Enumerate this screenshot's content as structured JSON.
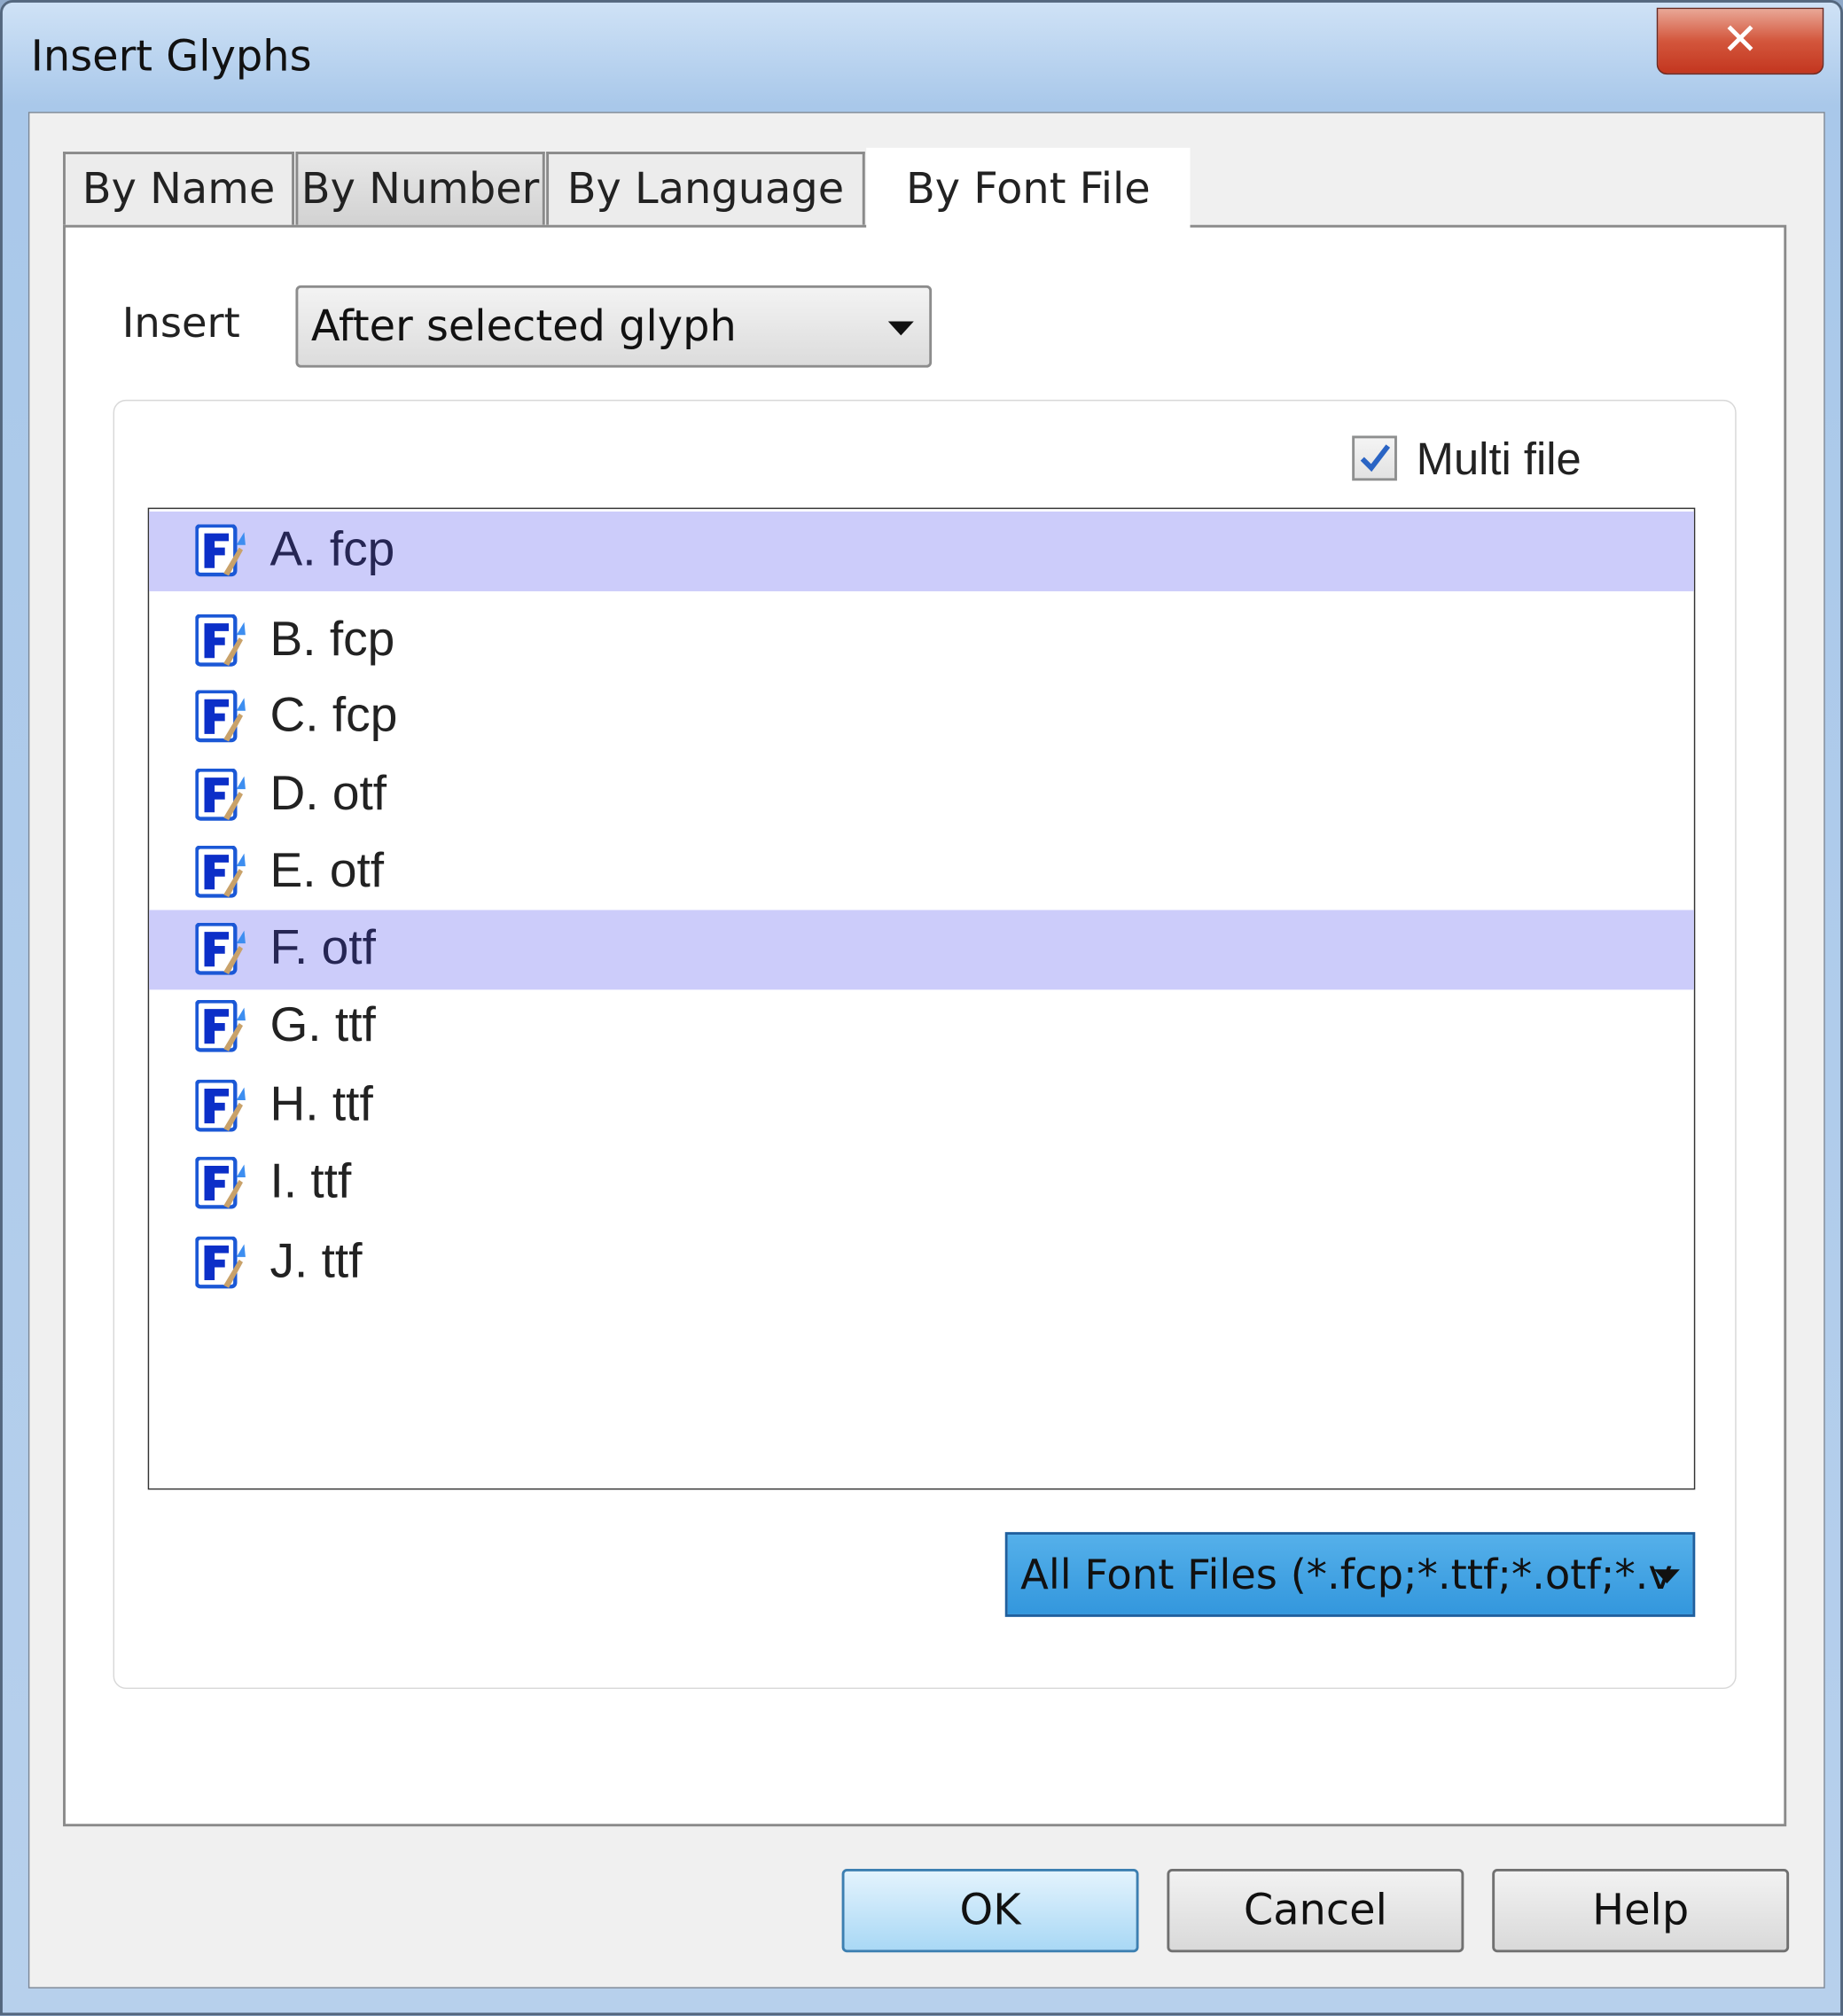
{
  "window": {
    "title": "Insert Glyphs",
    "close_icon": "close-icon"
  },
  "tabs": [
    {
      "label": "By Name"
    },
    {
      "label": "By Number"
    },
    {
      "label": "By Language"
    },
    {
      "label": "By Font File",
      "selected": true
    }
  ],
  "insert": {
    "label": "Insert",
    "value": "After selected glyph"
  },
  "multi_file": {
    "label": "Multi file",
    "checked": true
  },
  "files": [
    {
      "label": "A. fcp",
      "selected": true
    },
    {
      "label": "B. fcp"
    },
    {
      "label": "C. fcp"
    },
    {
      "label": "D. otf"
    },
    {
      "label": "E. otf"
    },
    {
      "label": "F. otf",
      "selected": true
    },
    {
      "label": "G. ttf"
    },
    {
      "label": "H. ttf"
    },
    {
      "label": "I. ttf"
    },
    {
      "label": "J. ttf"
    }
  ],
  "filter": {
    "value": "All Font Files (*.fcp;*.ttf;*.otf;*.v"
  },
  "buttons": {
    "ok": "OK",
    "cancel": "Cancel",
    "help": "Help"
  },
  "colors": {
    "selection": "#ccccfa",
    "accent": "#3397dd"
  }
}
